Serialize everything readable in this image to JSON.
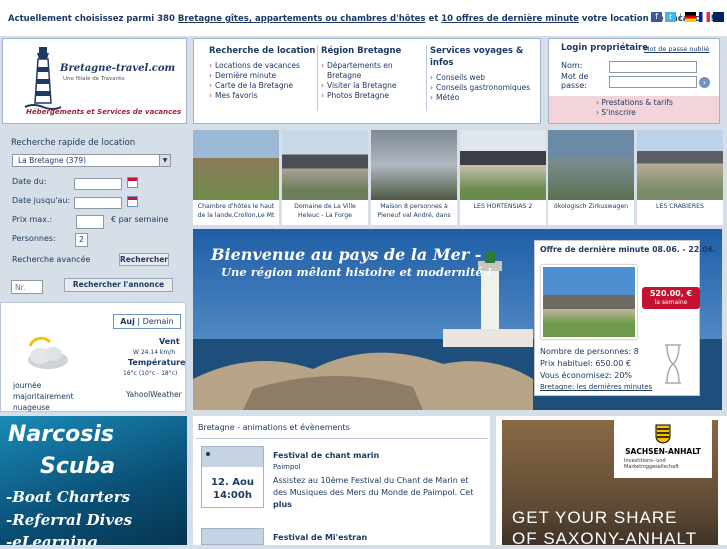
{
  "topbar": {
    "prefix": "Actuellement choisissez parmi 380",
    "link1": "Bretagne gîtes, appartements ou chambres d'hôtes",
    "mid": "et",
    "link2": "10 offres de dernière minute",
    "suffix": "votre location de vacances!",
    "separator": "|"
  },
  "logo": {
    "name": "Bretagne-travel.com",
    "subtitle": "Une filiale de Travanto",
    "tagline": "Hébergements et Services de vacances"
  },
  "nav": {
    "col1": {
      "title": "Recherche de location",
      "items": [
        "Locations de vacances",
        "Dernière minute",
        "Carte de la Bretagne",
        "Mes favoris"
      ]
    },
    "col2": {
      "title": "Région Bretagne",
      "items": [
        "Départements en Bretagne",
        "Visiter la Bretagne",
        "Photos Bretagne"
      ]
    },
    "col3": {
      "title": "Services voyages & infos",
      "items": [
        "Conseils web",
        "Conseils gastronomiques",
        "Météo"
      ]
    }
  },
  "login": {
    "title": "Login propriétaire",
    "forgot": "Mot de passe oublié",
    "name_label": "Nom:",
    "password_label": "Mot de passe:",
    "links": [
      "Prestations & tarifs",
      "S'inscrire"
    ]
  },
  "search": {
    "title": "Recherche rapide de location",
    "region_value": "La Bretagne (379)",
    "from_label": "Date du:",
    "to_label": "Date jusqu'au:",
    "price_label": "Prix max.:",
    "price_suffix": "€ par semaine",
    "persons_label": "Personnes:",
    "persons_value": "2",
    "advanced": "Recherche avancée",
    "search_btn": "Rechercher",
    "nr_placeholder": "Nr.",
    "annonce_btn": "Rechercher l'annonce"
  },
  "weather": {
    "tab_today": "Auj",
    "tab_sep": "|",
    "tab_tomorrow": "Demain",
    "wind_label": "Vent",
    "wind_value": "W 24.14 km/h",
    "temp_label": "Température",
    "temp_value": "16°c (10°c - 18°c)",
    "description": "journée majoritairement nuageuse",
    "provider": "YahoolWeather"
  },
  "thumbs": [
    {
      "caption": "Chambre d'hôtes le haut de la lande,Crollon,Le Mt",
      "color": "#8a7a5a"
    },
    {
      "caption": "Domaine de La Ville Heleuc - La Forge",
      "color": "#6d7f5a"
    },
    {
      "caption": "Maison 8 personnes à Pleneuf val André, dans",
      "color": "#7e8a96"
    },
    {
      "caption": "LES HORTENSIAS 2",
      "color": "#a9a08d"
    },
    {
      "caption": "ökologisch Zirkuswagen",
      "color": "#6a8aa6"
    },
    {
      "caption": "LES CRABIERES",
      "color": "#7c8c6b"
    }
  ],
  "banner": {
    "line1": "Bienvenue au pays de la Mer -",
    "line2": "Une région mêlant histoire et modernité !"
  },
  "offer": {
    "title": "Offre de dernière minute 08.06. - 22.06.",
    "price_badge": "520.00, €",
    "price_unit": "la semaine",
    "persons": "Nombre de personnes: 8",
    "usual": "Prix habituel: 650.00 €",
    "saving": "Vous économisez: 20%",
    "link": "Bretagne: les dernières minutes"
  },
  "events": {
    "header": "Bretagne - animations et évènements",
    "items": [
      {
        "day": "12. Aou",
        "time": "14:00h",
        "title": "Festival de chant marin",
        "place": "Paimpol",
        "desc": "Assistez au 10ème Festival du Chant de Marin et des Musiques des Mers du Monde de Paimpol. Cet",
        "more": "plus"
      },
      {
        "title": "Festival de Mi'estran"
      }
    ]
  },
  "ad_left": {
    "lines": [
      "Narcosis",
      "Scuba",
      "-Boat Charters",
      "-Referral Dives",
      "-eLearning"
    ]
  },
  "ad_right": {
    "brand": "SACHSEN-ANHALT",
    "brand_sub": "Investitions- und Marketinggesellschaft",
    "line1": "GET YOUR SHARE",
    "line2": "OF SAXONY-ANHALT"
  },
  "colors": {
    "accent": "#1d3a63",
    "pink": "#f3d4da",
    "red": "#c41230"
  }
}
